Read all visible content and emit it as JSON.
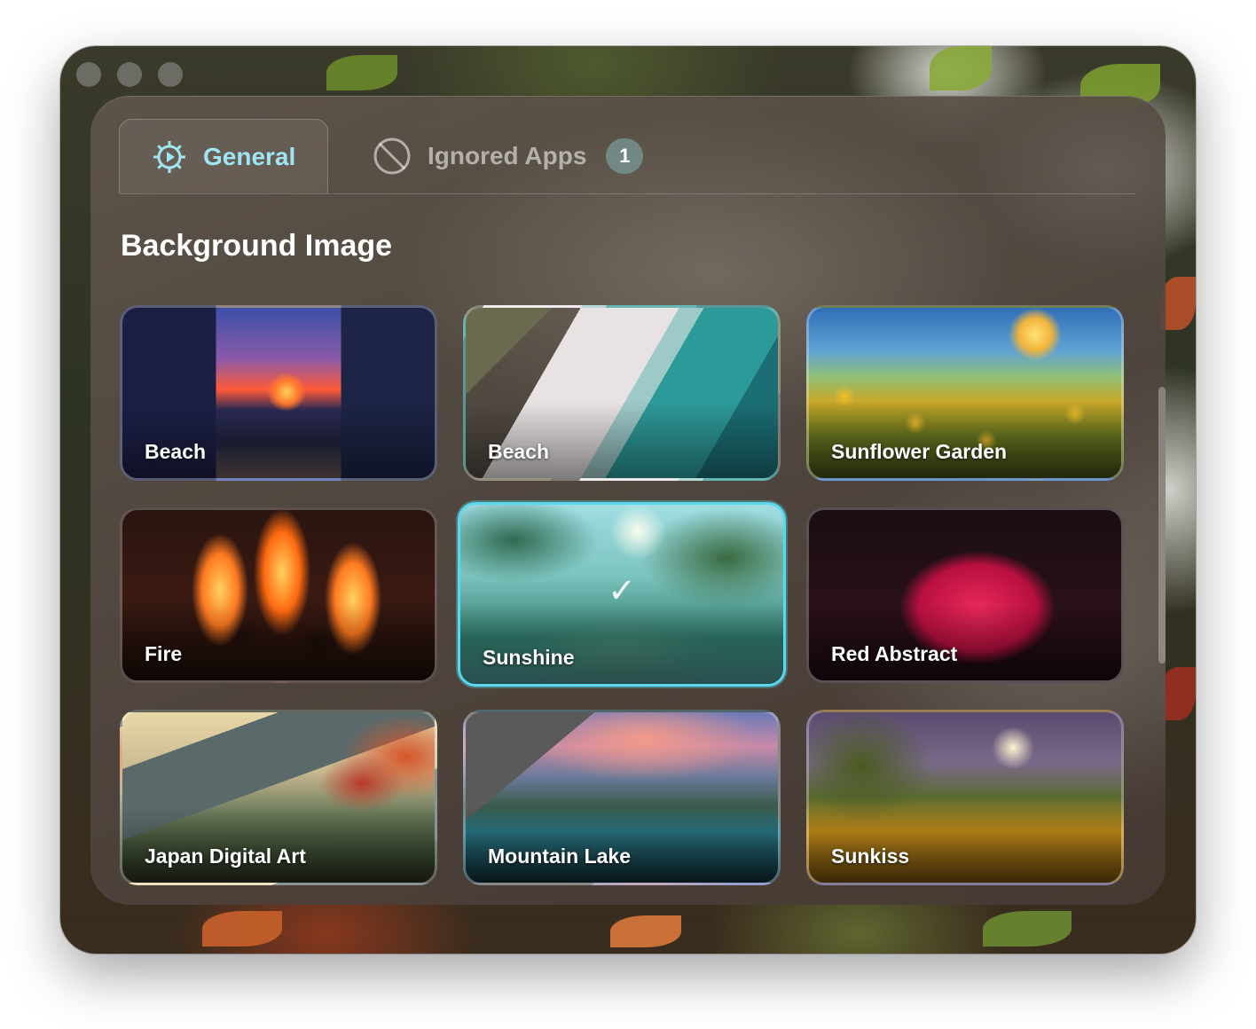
{
  "window": {
    "traffic_lights": [
      "close",
      "minimize",
      "zoom"
    ]
  },
  "tabs": [
    {
      "label": "General",
      "icon": "gear-icon",
      "active": true,
      "color": "#9fe6f2"
    },
    {
      "label": "Ignored Apps",
      "icon": "no-apps-icon",
      "active": false,
      "badge": "1"
    }
  ],
  "section": {
    "title": "Background Image"
  },
  "images": [
    {
      "label": "Beach",
      "art": "beach1",
      "selected": false
    },
    {
      "label": "Beach",
      "art": "beach2",
      "selected": false
    },
    {
      "label": "Sunflower Garden",
      "art": "sunflower",
      "selected": false
    },
    {
      "label": "Fire",
      "art": "fire",
      "selected": false
    },
    {
      "label": "Sunshine",
      "art": "sunshine",
      "selected": true
    },
    {
      "label": "Red Abstract",
      "art": "red",
      "selected": false
    },
    {
      "label": "Japan Digital Art",
      "art": "japan",
      "selected": false
    },
    {
      "label": "Mountain Lake",
      "art": "mountain",
      "selected": false
    },
    {
      "label": "Sunkiss",
      "art": "sunkiss",
      "selected": false
    }
  ],
  "colors": {
    "accent": "#59d8ee",
    "active_tab_text": "#9fe6f2"
  }
}
